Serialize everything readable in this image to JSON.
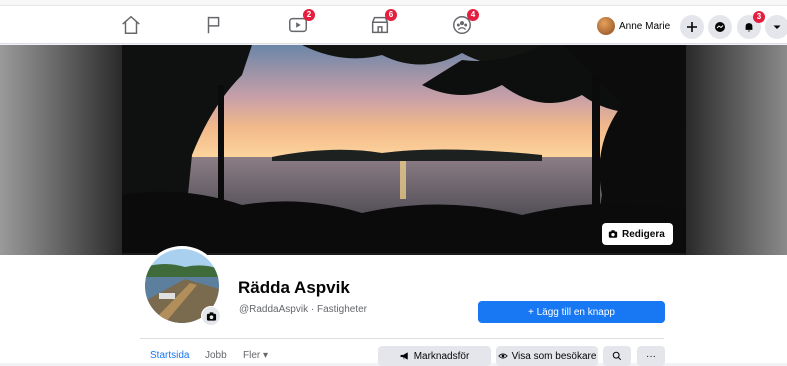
{
  "topnav": {
    "items": [
      {
        "name": "home",
        "badge": ""
      },
      {
        "name": "pages",
        "badge": ""
      },
      {
        "name": "watch",
        "badge": "2"
      },
      {
        "name": "marketplace",
        "badge": "6"
      },
      {
        "name": "groups",
        "badge": "4"
      }
    ],
    "profile_name": "Anne Marie",
    "notifications_badge": "3"
  },
  "cover": {
    "edit_label": "Redigera"
  },
  "page": {
    "name": "Rädda Aspvik",
    "handle": "@RaddaAspvik · Fastigheter",
    "add_button_label": "+  Lägg till en knapp"
  },
  "tabs": {
    "home": "Startsida",
    "jobs": "Jobb",
    "more": "Fler ▾"
  },
  "actions": {
    "promote": "Marknadsför",
    "view_as": "Visa som besökare",
    "more": "···"
  },
  "colors": {
    "accent": "#1877f2",
    "badge": "#e41e3f"
  }
}
